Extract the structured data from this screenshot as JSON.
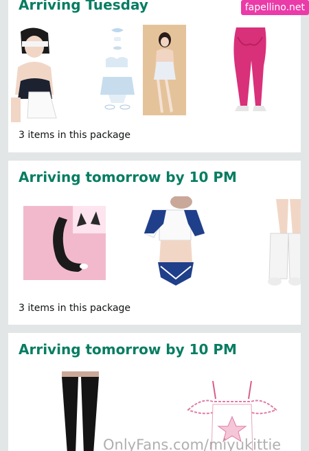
{
  "packages": [
    {
      "title": "Arriving Tuesday",
      "count_text": "3 items in this package"
    },
    {
      "title": "Arriving tomorrow by 10 PM",
      "count_text": "3 items in this package"
    },
    {
      "title": "Arriving tomorrow by 10 PM"
    }
  ],
  "watermark": {
    "badge": "fapellino.net",
    "text": "OnlyFans.com/miyukittie"
  },
  "colors": {
    "title_green": "#067d62",
    "page_bg": "#e3e6e6",
    "badge_pink": "#ea3ba8"
  }
}
